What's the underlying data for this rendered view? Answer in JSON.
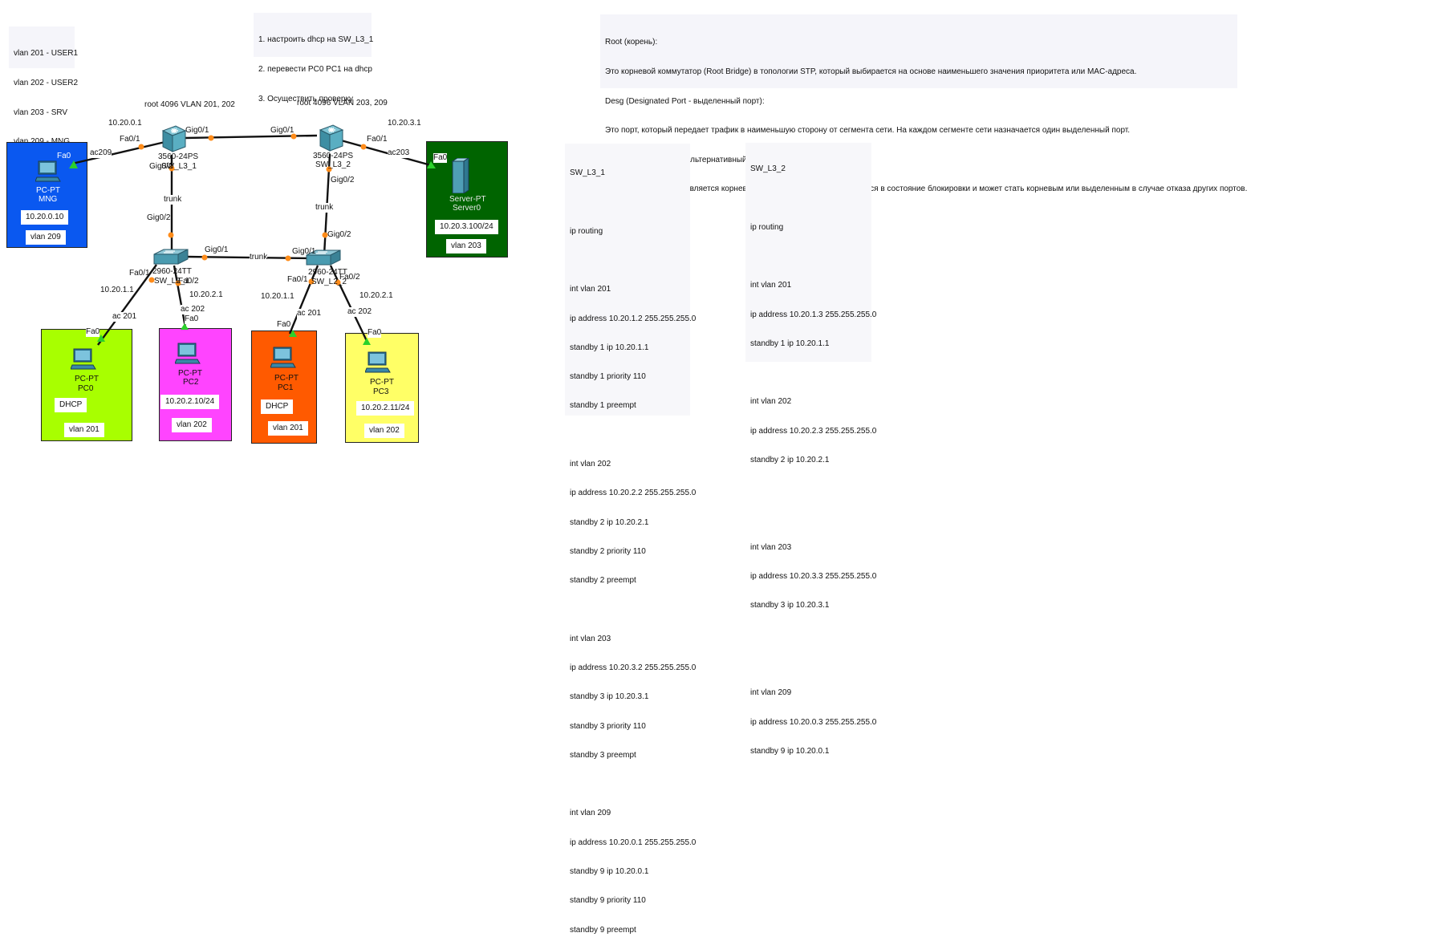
{
  "notes": {
    "vlans": [
      "vlan 201 - USER1",
      "vlan 202 - USER2",
      "vlan 203 - SRV",
      "vlan 209 - MNG"
    ],
    "tasks": [
      "1. настроить dhcp на SW_L3_1",
      "2. перевести PC0 PC1 на dhcp",
      "3. Осуществить проверку"
    ],
    "stp": [
      "Root (корень):",
      "Это корневой коммутатор (Root Bridge) в топологии STP, который выбирается на основе наименьшего значения приоритета или MAC-адреса.",
      "Desg (Designated Port - выделенный порт):",
      "Это порт, который передает трафик в наименьшую сторону от сегмента сети. На каждом сегменте сети назначается один выделенный порт.",
      "Altn (Alternative Port - альтернативный порт):",
      "Это порт, который не является корневым или выделенным, но находится в состояние блокировки и может стать корневым или выделенным в случае отказа других портов."
    ]
  },
  "colors": {
    "mng_area": "#0a58f0",
    "srv_area": "#006400",
    "pc0_area": "#a8ff00",
    "pc2_area": "#ff44ff",
    "pc1_area": "#ff5a00",
    "pc3_area": "#ffff66",
    "link_up": "#2bd12b",
    "port_dot": "#ff8c1a"
  },
  "switches": {
    "sw_l3_1": {
      "model": "3560-24PS",
      "name": "SW_L3_1",
      "root_note": "root 4096 VLAN 201, 202",
      "ip": "10.20.0.1"
    },
    "sw_l3_2": {
      "model": "3560-24PS",
      "name": "SW_L3_2",
      "root_note": "root 4096 VLAN 203, 209",
      "ip": "10.20.3.1"
    },
    "sw_l2_1": {
      "model": "2960-24TT",
      "name": "SW_L2_1"
    },
    "sw_l2_2": {
      "model": "2960-24TT",
      "name": "SW_L2_2"
    }
  },
  "ports": {
    "l31_fa01": "Fa0/1",
    "l31_gig01": "Gig0/1",
    "l31_gig02": "Gig0/2",
    "l32_gig01": "Gig0/1",
    "l32_fa01": "Fa0/1",
    "l32_gig02": "Gig0/2",
    "l21_gig02": "Gig0/2",
    "l21_gig01": "Gig0/1",
    "l21_fa01": "Fa0/1",
    "l21_fa02": "Fa0/2",
    "l22_gig01": "Gig0/1",
    "l22_gig02": "Gig0/2",
    "l22_fa01": "Fa0/1",
    "l22_fa02": "Fa0/2"
  },
  "links": {
    "trunk_l31": "trunk",
    "trunk_l32": "trunk",
    "trunk_l2": "trunk",
    "ac209": "ac209",
    "ac203": "ac203",
    "ac201_a": "ac 201",
    "ac202_a": "ac 202",
    "ac201_b": "ac 201",
    "ac202_b": "ac 202"
  },
  "gateways": {
    "pc0": "10.20.1.1",
    "pc2": "10.20.2.1",
    "pc1": "10.20.1.1",
    "pc3": "10.20.2.1"
  },
  "hosts": {
    "mng": {
      "port": "Fa0",
      "type": "PC-PT",
      "name": "MNG",
      "ip": "10.20.0.10",
      "vlan": "vlan 209"
    },
    "server0": {
      "port": "Fa0",
      "type": "Server-PT",
      "name": "Server0",
      "ip": "10.20.3.100/24",
      "vlan": "vlan 203"
    },
    "pc0": {
      "port": "Fa0",
      "type": "PC-PT",
      "name": "PC0",
      "ip": "DHCP",
      "vlan": "vlan 201"
    },
    "pc2": {
      "port": "Fa0",
      "type": "PC-PT",
      "name": "PC2",
      "ip": "10.20.2.10/24",
      "vlan": "vlan 202"
    },
    "pc1": {
      "port": "Fa0",
      "type": "PC-PT",
      "name": "PC1",
      "ip": "DHCP",
      "vlan": "vlan 201"
    },
    "pc3": {
      "port": "Fa0",
      "type": "PC-PT",
      "name": "PC3",
      "ip": "10.20.2.11/24",
      "vlan": "vlan 202"
    }
  },
  "configs": {
    "sw_l3_1": [
      "SW_L3_1",
      "",
      "ip routing",
      "",
      "int vlan 201",
      "ip address 10.20.1.2 255.255.255.0",
      "standby 1 ip 10.20.1.1",
      "standby 1 priority 110",
      "standby 1 preempt",
      "",
      "int vlan 202",
      "ip address 10.20.2.2 255.255.255.0",
      "standby 2 ip 10.20.2.1",
      "standby 2 priority 110",
      "standby 2 preempt",
      "",
      "int vlan 203",
      "ip address 10.20.3.2 255.255.255.0",
      "standby 3 ip 10.20.3.1",
      "standby 3 priority 110",
      "standby 3 preempt",
      "",
      "int vlan 209",
      "ip address 10.20.0.1 255.255.255.0",
      "standby 9 ip 10.20.0.1",
      "standby 9 priority 110",
      "standby 9 preempt"
    ],
    "sw_l3_2": [
      "SW_L3_2",
      "",
      "ip routing",
      "",
      "int vlan 201",
      "ip address 10.20.1.3 255.255.255.0",
      "standby 1 ip 10.20.1.1",
      "",
      "int vlan 202",
      "ip address 10.20.2.3 255.255.255.0",
      "standby 2 ip 10.20.2.1",
      "",
      "",
      "int vlan 203",
      "ip address 10.20.3.3 255.255.255.0",
      "standby 3 ip 10.20.3.1",
      "",
      "",
      "int vlan 209",
      "ip address 10.20.0.3 255.255.255.0",
      "standby 9 ip 10.20.0.1"
    ]
  }
}
